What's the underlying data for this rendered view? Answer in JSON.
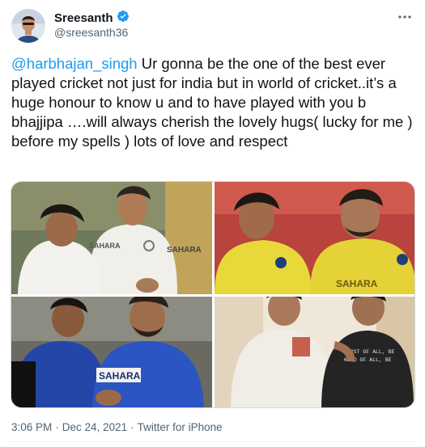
{
  "author": {
    "display_name": "Sreesanth",
    "handle": "@sreesanth36",
    "verified": true
  },
  "tweet": {
    "mention": "@harbhajan_singh",
    "body": " Ur gonna be the one of the best ever played cricket not just for india but in world of cricket..it’s a huge honour to know u and  to have played with you b bhajjipa ….will always cherish the lovely hugs( lucky for me ) before my spells ) lots of love and respect"
  },
  "media": {
    "photos": [
      {
        "label": "photo-1",
        "jersey_text": "SAHARA"
      },
      {
        "label": "photo-2",
        "jersey_text": "SAHARA"
      },
      {
        "label": "photo-3",
        "jersey_text": "SAHARA"
      },
      {
        "label": "photo-4",
        "shirt_text_line1": "FIRST OF ALL, BE",
        "shirt_text_line2": "KIND OF ALL, BE"
      }
    ]
  },
  "footer": {
    "time": "3:06 PM",
    "date": "Dec 24, 2021",
    "separator": "·",
    "source": "Twitter for iPhone"
  },
  "colors": {
    "accent": "#1d9bf0",
    "secondary_text": "#536471",
    "primary_text": "#0f1419"
  },
  "icons": {
    "verified": "verified-badge-icon",
    "more": "more-horizontal-icon"
  }
}
